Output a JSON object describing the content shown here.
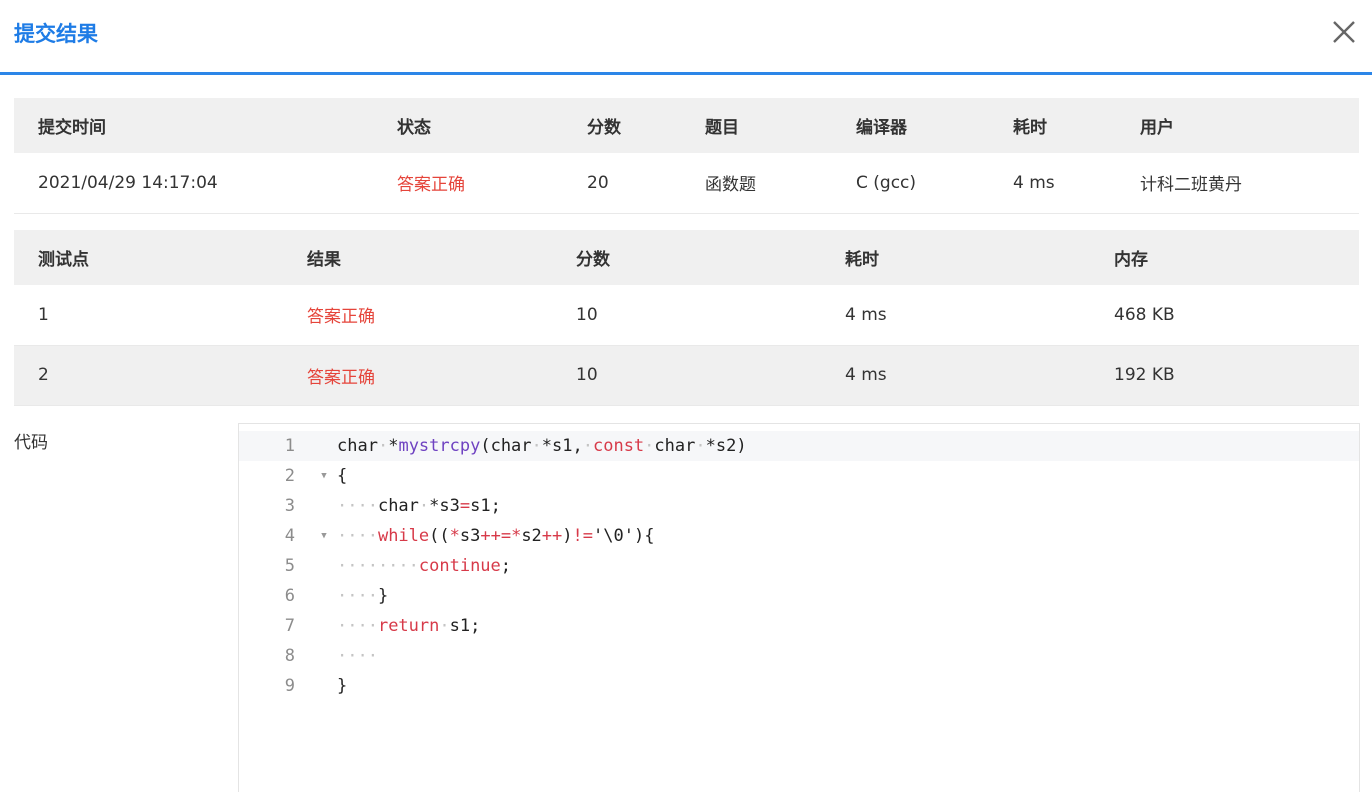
{
  "dialog": {
    "title": "提交结果",
    "close_icon": "close-icon"
  },
  "summary": {
    "headers": [
      "提交时间",
      "状态",
      "分数",
      "题目",
      "编译器",
      "耗时",
      "用户"
    ],
    "row": {
      "time": "2021/04/29 14:17:04",
      "status": "答案正确",
      "score": "20",
      "problem": "函数题",
      "compiler": "C (gcc)",
      "elapsed": "4 ms",
      "user": "计科二班黄丹"
    }
  },
  "cases": {
    "headers": [
      "测试点",
      "结果",
      "分数",
      "耗时",
      "内存"
    ],
    "rows": [
      {
        "id": "1",
        "result": "答案正确",
        "score": "10",
        "time": "4 ms",
        "memory": "468 KB"
      },
      {
        "id": "2",
        "result": "答案正确",
        "score": "10",
        "time": "4 ms",
        "memory": "192 KB"
      }
    ]
  },
  "code": {
    "label": "代码",
    "lines": [
      {
        "n": "1",
        "fold": false
      },
      {
        "n": "2",
        "fold": true
      },
      {
        "n": "3",
        "fold": false
      },
      {
        "n": "4",
        "fold": true
      },
      {
        "n": "5",
        "fold": false
      },
      {
        "n": "6",
        "fold": false
      },
      {
        "n": "7",
        "fold": false
      },
      {
        "n": "8",
        "fold": false
      },
      {
        "n": "9",
        "fold": false
      }
    ],
    "source": {
      "l1_a": "char",
      "l1_b": "*",
      "l1_fn": "mystrcpy",
      "l1_c": "(char",
      "l1_d": "*s1,",
      "l1_kw": "const",
      "l1_e": "char",
      "l1_f": "*s2)",
      "l2": "{",
      "l3_a": "char",
      "l3_b": "*s3",
      "l3_op": "=",
      "l3_c": "s1;",
      "l4_kw": "while",
      "l4_a": "((",
      "l4_op1": "*",
      "l4_b": "s3",
      "l4_op2": "++=*",
      "l4_c": "s2",
      "l4_op3": "++",
      "l4_d": ")",
      "l4_op4": "!=",
      "l4_e": "'\\0'){",
      "l5_kw": "continue",
      "l5_a": ";",
      "l6": "}",
      "l7_kw": "return",
      "l7_a": "s1;",
      "l9": "}"
    }
  }
}
